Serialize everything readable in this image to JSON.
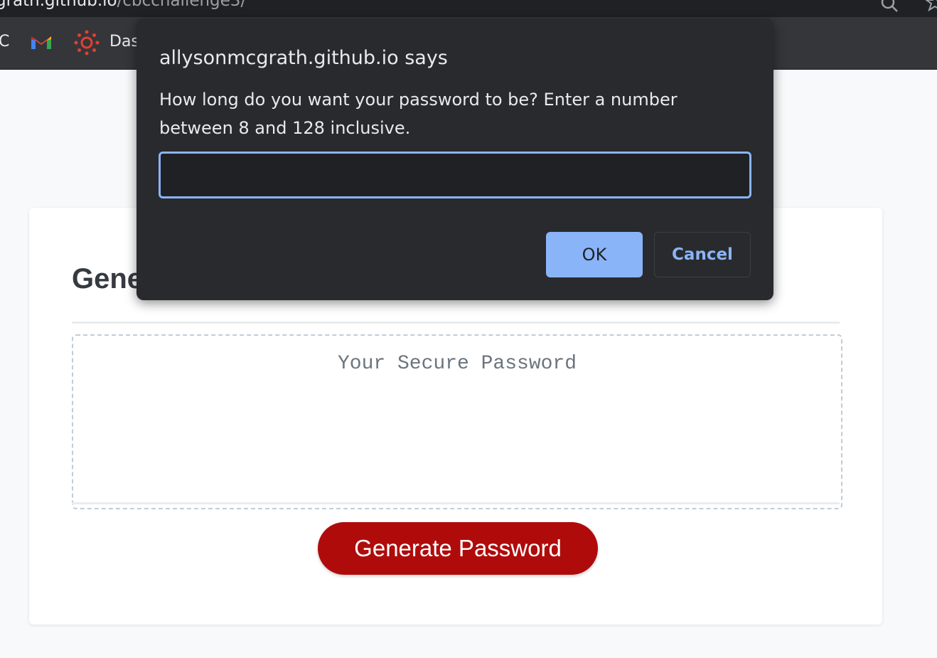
{
  "browser": {
    "url_host_partial": "grath.github.io",
    "url_path_partial": "/cbcchallenge3/",
    "bookmarks": {
      "partial_label": "C",
      "items": [
        {
          "icon": "gmail-icon"
        },
        {
          "icon": "canvas-icon",
          "label_partial": "Das"
        }
      ]
    }
  },
  "page": {
    "card_title_partial": "Gene",
    "password_placeholder": "Your Secure Password",
    "generate_button": "Generate Password"
  },
  "dialog": {
    "title": "allysonmcgrath.github.io says",
    "message": "How long do you want your password to be? Enter a number between 8 and 128 inclusive.",
    "input_value": "",
    "ok_label": "OK",
    "cancel_label": "Cancel"
  },
  "colors": {
    "generate_button_bg": "#b00b0b",
    "dialog_bg": "#292a2d",
    "dialog_accent": "#8ab4f8",
    "page_bg": "#f8f9fa"
  }
}
